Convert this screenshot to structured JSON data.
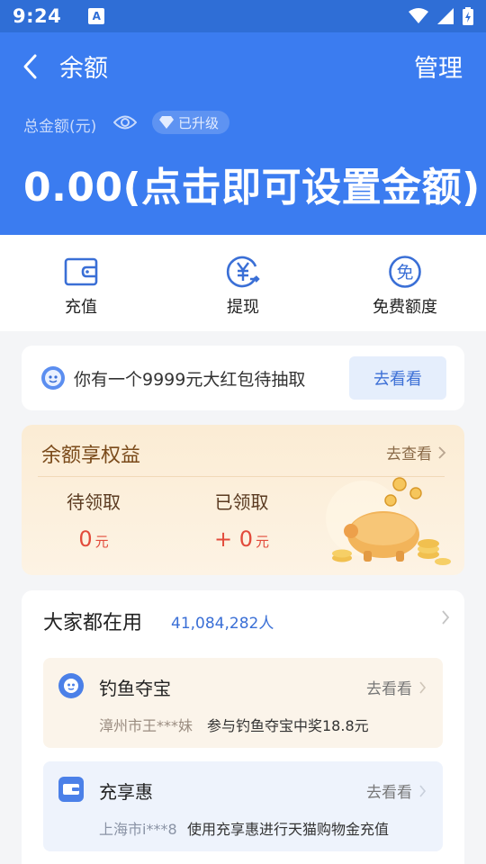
{
  "status": {
    "time": "9:24",
    "notif_icon": "A"
  },
  "header": {
    "title": "余额",
    "manage": "管理",
    "total_label": "总金额(元)",
    "badge": "已升级",
    "amount": "0.00(点击即可设置金额)",
    "color": "#3b7cf0"
  },
  "actions": [
    {
      "label": "充值",
      "icon": "wallet-icon"
    },
    {
      "label": "提现",
      "icon": "withdraw-yen-icon"
    },
    {
      "label": "免费额度",
      "icon": "free-quota-icon"
    }
  ],
  "redpacket": {
    "text": "你有一个9999元大红包待抽取",
    "button": "去看看"
  },
  "benefits": {
    "title": "余额享权益",
    "more": "去查看",
    "pending": {
      "label": "待领取",
      "value": "0",
      "unit": "元"
    },
    "received": {
      "label": "已领取",
      "value": "+ 0",
      "unit": "元"
    }
  },
  "everyone": {
    "title": "大家都在用",
    "count": "41,084,282人",
    "items": [
      {
        "name": "钓鱼夺宝",
        "go": "去看看",
        "user": "漳州市王***妹",
        "desc": "参与钓鱼夺宝中奖18.8元"
      },
      {
        "name": "充享惠",
        "go": "去看看",
        "user": "上海市i***8",
        "desc": "使用充享惠进行天猫购物金充值"
      }
    ]
  }
}
